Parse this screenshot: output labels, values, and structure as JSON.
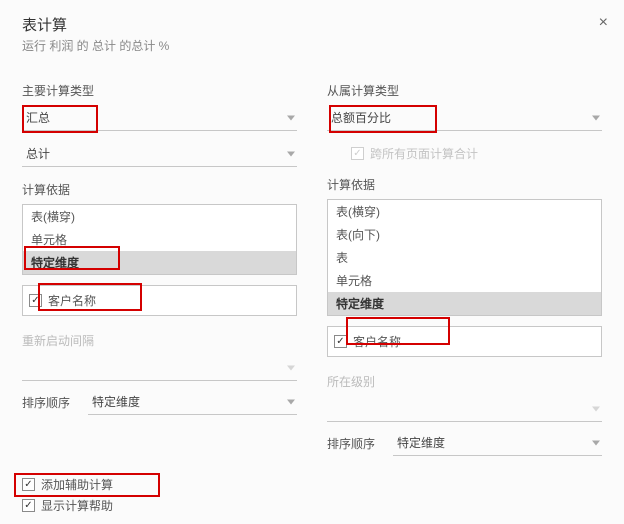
{
  "header": {
    "title": "表计算",
    "subtitle": "运行 利润 的 总计 的总计 %"
  },
  "left": {
    "section_label": "主要计算类型",
    "dd1": "汇总",
    "dd2": "总计",
    "calc_basis_label": "计算依据",
    "list": [
      "表(横穿)",
      "单元格",
      "特定维度"
    ],
    "list_selected_index": 2,
    "checkbox_dim": {
      "checked": true,
      "label": "客户名称"
    },
    "restart_label": "重新启动间隔",
    "restart_value": "",
    "sort_label": "排序顺序",
    "sort_value": "特定维度"
  },
  "right": {
    "section_label": "从属计算类型",
    "dd1": "总额百分比",
    "all_pages": {
      "checked": false,
      "label": "跨所有页面计算合计"
    },
    "calc_basis_label": "计算依据",
    "list": [
      "表(横穿)",
      "表(向下)",
      "表",
      "单元格",
      "特定维度"
    ],
    "list_selected_index": 4,
    "checkbox_dim": {
      "checked": true,
      "label": "客户名称"
    },
    "level_label": "所在级别",
    "level_value": "",
    "sort_label": "排序顺序",
    "sort_value": "特定维度"
  },
  "footer": {
    "add_aux": {
      "checked": true,
      "label": "添加辅助计算"
    },
    "show_help": {
      "checked": true,
      "label": "显示计算帮助"
    }
  }
}
